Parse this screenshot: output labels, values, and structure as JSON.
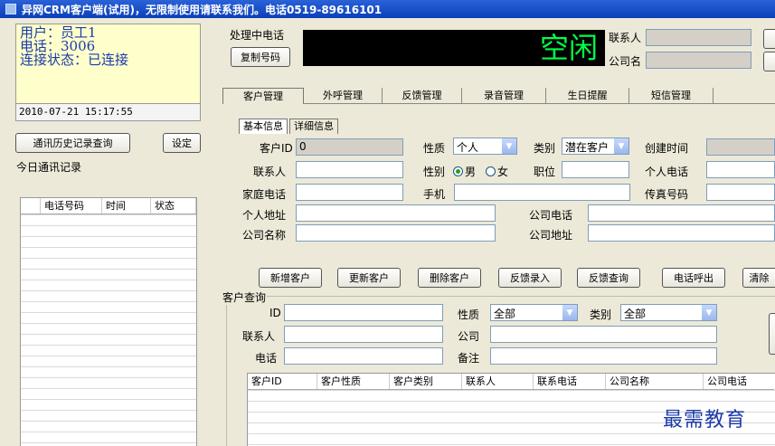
{
  "window": {
    "title": "异网CRM客户端(试用)，无限制使用请联系我们。电话0519-89616101"
  },
  "user_panel": {
    "user": "用户：员工1",
    "phone": "电话：3006",
    "connection": "连接状态：已连接"
  },
  "datetime": "2010-07-21 15:17:55",
  "left_buttons": {
    "history": "通讯历史记录查询",
    "settings": "设定"
  },
  "today_title": "今日通讯记录",
  "call_table": {
    "columns": [
      "电话号码",
      "时间",
      "状态"
    ]
  },
  "call_header": {
    "processing_label": "处理中电话",
    "copy_button": "复制号码",
    "status_text": "空闲",
    "contact_label": "联系人",
    "company_label": "公司名"
  },
  "tabs": [
    "客户管理",
    "外呼管理",
    "反馈管理",
    "录音管理",
    "生日提醒",
    "短信管理"
  ],
  "subtabs": [
    "基本信息",
    "详细信息"
  ],
  "form": {
    "customer_id_label": "客户ID",
    "customer_id_value": "0",
    "nature_label": "性质",
    "nature_value": "个人",
    "category_label": "类别",
    "category_value": "潜在客户",
    "created_label": "创建时间",
    "contact_label": "联系人",
    "gender_label": "性别",
    "gender_male": "男",
    "gender_female": "女",
    "position_label": "职位",
    "personal_phone_label": "个人电话",
    "home_phone_label": "家庭电话",
    "mobile_label": "手机",
    "fax_label": "传真号码",
    "personal_address_label": "个人地址",
    "company_phone_label": "公司电话",
    "company_name_label": "公司名称",
    "company_address_label": "公司地址"
  },
  "actions": [
    "新增客户",
    "更新客户",
    "删除客户",
    "反馈录入",
    "反馈查询",
    "电话呼出",
    "清除"
  ],
  "query": {
    "legend": "客户查询",
    "id_label": "ID",
    "nature_label": "性质",
    "nature_value": "全部",
    "category_label": "类别",
    "category_value": "全部",
    "contact_label": "联系人",
    "company_label": "公司",
    "phone_label": "电话",
    "remark_label": "备注"
  },
  "query_table": {
    "columns": [
      "客户ID",
      "客户性质",
      "客户类别",
      "联系人",
      "联系电话",
      "公司名称",
      "公司电话"
    ]
  },
  "watermark": "最需教育",
  "colors": {
    "title_bar": "#0b3fb8",
    "status_green": "#00ff44",
    "user_text": "#1a3aa8",
    "user_bg": "#ffffcc"
  }
}
